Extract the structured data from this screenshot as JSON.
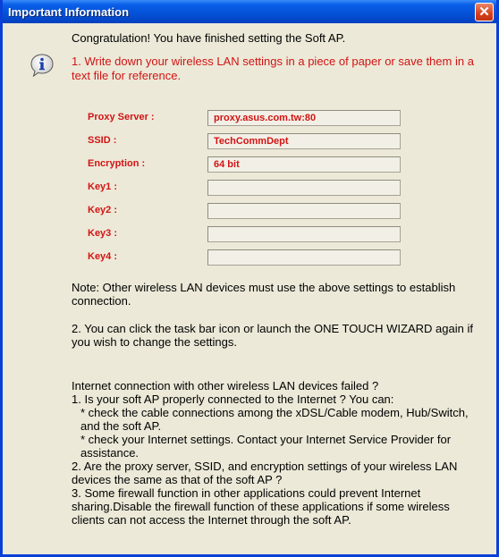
{
  "window": {
    "title": "Important Information",
    "close_symbol": "✕"
  },
  "icon": "info-icon",
  "congrats": "Congratulation! You have finished setting the Soft AP.",
  "step1": "1. Write down your wireless LAN settings in a piece of paper or save them in a text file for reference.",
  "fields": [
    {
      "label": "Proxy Server :",
      "value": "proxy.asus.com.tw:80"
    },
    {
      "label": "SSID :",
      "value": "TechCommDept"
    },
    {
      "label": "Encryption :",
      "value": "64 bit"
    },
    {
      "label": "Key1 :",
      "value": ""
    },
    {
      "label": "Key2 :",
      "value": ""
    },
    {
      "label": "Key3 :",
      "value": ""
    },
    {
      "label": "Key4 :",
      "value": ""
    }
  ],
  "note": "Note: Other wireless LAN devices must use the above settings to establish connection.",
  "step2": "2. You can click the task bar icon or launch the ONE TOUCH WIZARD again if you wish to change the settings.",
  "troubleshoot": {
    "heading": "Internet connection with other wireless LAN devices failed ?",
    "item1": "1. Is your soft AP properly connected to the Internet ? You can:",
    "item1a": "* check the cable connections among the xDSL/Cable modem, Hub/Switch, and the soft AP.",
    "item1b": "* check your Internet settings. Contact your Internet Service Provider for assistance.",
    "item2": "2. Are the proxy server, SSID, and encryption settings of your wireless LAN devices the same as that of the soft AP ?",
    "item3": "3. Some firewall function in other applications could prevent Internet sharing.Disable the firewall function of these applications if some wireless clients can not access the Internet through the soft AP."
  },
  "colors": {
    "titlebar": "#0451d6",
    "client_bg": "#ece9d8",
    "accent_red": "#d11414"
  }
}
